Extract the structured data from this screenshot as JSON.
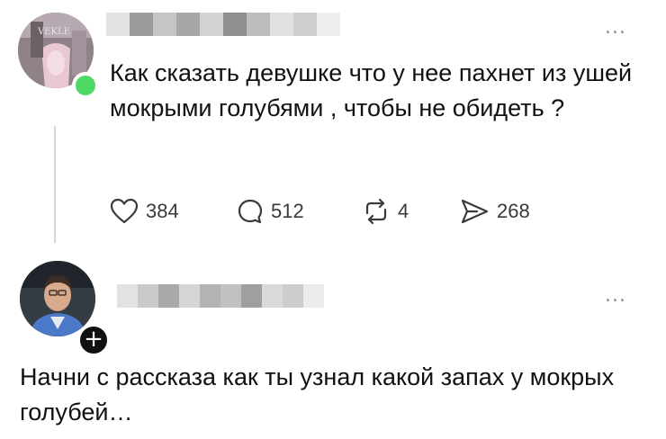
{
  "posts": [
    {
      "avatar": "profile-photo",
      "status": "online",
      "menu_icon": "more-dots-icon",
      "more_label": "...",
      "text": "Как сказать девушке что у нее пахнет из ушей мокрыми голубями , чтобы не обидеть ?",
      "stats": {
        "likes": "384",
        "comments": "512",
        "reposts": "4",
        "shares": "268"
      }
    },
    {
      "avatar": "profile-photo",
      "badge_icon": "plus-icon",
      "badge_label": "+",
      "menu_icon": "more-dots-icon",
      "more_label": "...",
      "text": "Начни с рассказа как ты узнал какой запах у мокрых голубей…"
    }
  ],
  "icons": [
    "heart-icon",
    "comment-icon",
    "repost-icon",
    "share-icon"
  ],
  "colors": {
    "online": "#4cd964",
    "badge": "#111111",
    "text": "#111111",
    "muted": "#3a3a3a",
    "thread": "#d7d7d7"
  }
}
